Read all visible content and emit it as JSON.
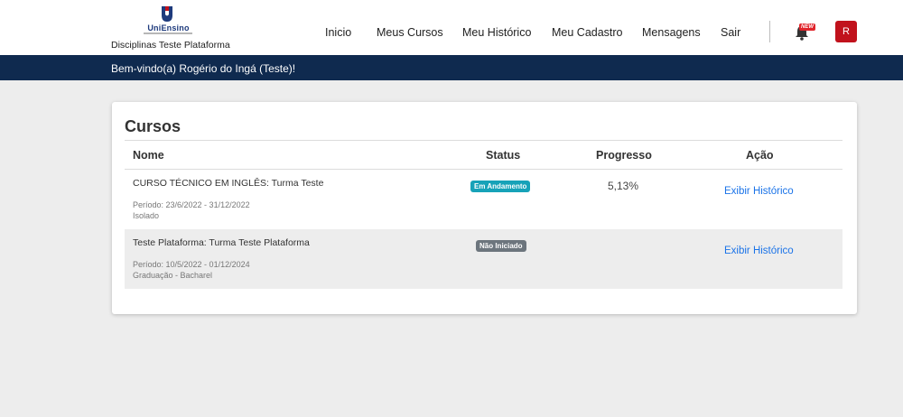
{
  "header": {
    "logo_text": "UniEnsino",
    "site_name": "Disciplinas Teste Plataforma",
    "nav": [
      {
        "label": "Inicio"
      },
      {
        "label": "Meus Cursos"
      },
      {
        "label": "Meu Histórico"
      },
      {
        "label": "Meu Cadastro"
      },
      {
        "label": "Mensagens"
      },
      {
        "label": "Sair"
      }
    ],
    "notification_badge": "NEW",
    "avatar_initial": "R"
  },
  "welcome": "Bem-vindo(a) Rogério do Ingá (Teste)!",
  "courses": {
    "title": "Cursos",
    "columns": [
      "Nome",
      "Status",
      "Progresso",
      "Ação"
    ],
    "rows": [
      {
        "name": "CURSO TÉCNICO EM INGLÊS: Turma Teste",
        "period": "Período: 23/6/2022 - 31/12/2022",
        "category": "Isolado",
        "status": "Em Andamento",
        "progress": "5,13%",
        "action": "Exibir Histórico"
      },
      {
        "name": "Teste Plataforma: Turma Teste Plataforma",
        "period": "Período: 10/5/2022 - 01/12/2024",
        "category": "Graduação - Bacharel",
        "status": "Não Iniciado",
        "progress": "",
        "action": "Exibir Histórico"
      }
    ]
  },
  "colors": {
    "navy": "#0f2a4f",
    "brand_red": "#c1121c",
    "status_in_progress": "#17a2b8",
    "status_not_started": "#6c757d",
    "link": "#1a73e8"
  },
  "icons": {
    "logo": "u-shield-logo",
    "notifications": "bell-icon"
  }
}
